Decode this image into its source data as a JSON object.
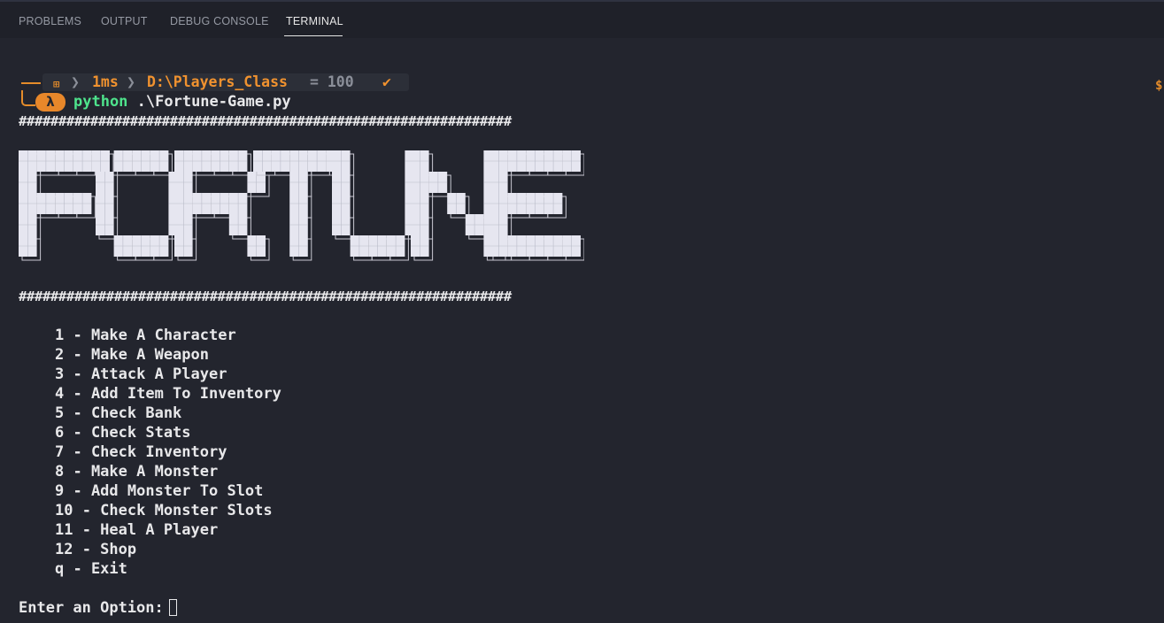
{
  "tabs": [
    {
      "label": "PROBLEMS"
    },
    {
      "label": "OUTPUT"
    },
    {
      "label": "DEBUG CONSOLE"
    },
    {
      "label": "TERMINAL",
      "active": true
    }
  ],
  "prompt": {
    "os_icon": "windows-icon",
    "duration": "1ms",
    "path": "D:\\Players_Class",
    "battery": "= 100",
    "status": "✔",
    "lambda": "λ",
    "right_glyph": "$"
  },
  "command": {
    "program": "python",
    "args": " .\\Fortune-Game.py"
  },
  "separator": "##############################################################",
  "banner": {
    "word": "FORTUNE",
    "glyphs": {
      "F": [
        "11111",
        "10000",
        "11110",
        "10000",
        "10000"
      ],
      "O": [
        "01110",
        "10001",
        "10001",
        "10001",
        "01110"
      ],
      "R": [
        "11110",
        "10001",
        "11110",
        "10010",
        "10001"
      ],
      "T": [
        "11111",
        "00100",
        "00100",
        "00100",
        "00100"
      ],
      "U": [
        "10001",
        "10001",
        "10001",
        "10001",
        "01110"
      ],
      "N": [
        "10001",
        "11001",
        "10101",
        "10011",
        "10001"
      ],
      "E": [
        "11111",
        "10000",
        "11110",
        "10000",
        "11111"
      ]
    },
    "fill_color": "#e6e6f0",
    "outline_color": "#c8c8d2"
  },
  "menu": [
    "1 - Make A Character",
    "2 - Make A Weapon",
    "3 - Attack A Player",
    "4 - Add Item To Inventory",
    "5 - Check Bank",
    "6 - Check Stats",
    "7 - Check Inventory",
    "8 - Make A Monster",
    "9 - Add Monster To Slot",
    "10 - Check Monster Slots",
    "11 - Heal A Player",
    "12 - Shop",
    "q - Exit"
  ],
  "input_prompt": "Enter an Option:",
  "colors": {
    "background": "#23252e",
    "tabbar": "#1f2129",
    "accent_orange": "#f0922f",
    "python_green": "#4ee38c",
    "text": "#e8e8ea"
  }
}
